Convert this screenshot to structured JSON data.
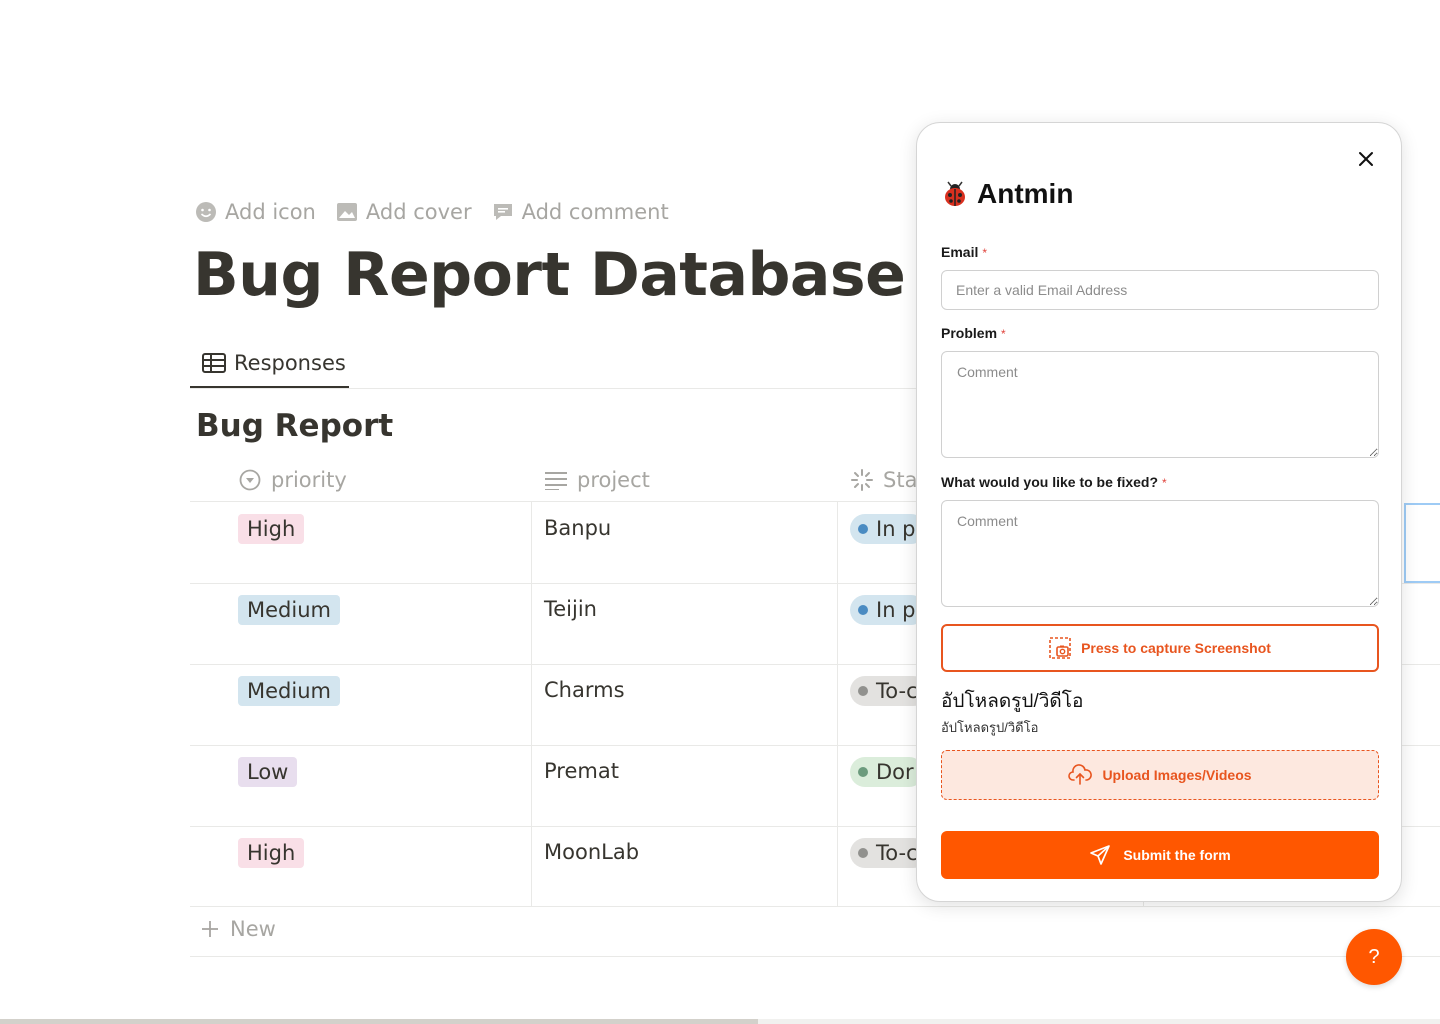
{
  "page": {
    "actions": [
      {
        "label": "Add icon",
        "icon": "smiley-icon"
      },
      {
        "label": "Add cover",
        "icon": "image-icon"
      },
      {
        "label": "Add comment",
        "icon": "comment-icon"
      }
    ],
    "title": "Bug Report Database",
    "view_tab": {
      "label": "Responses",
      "icon": "table-icon"
    },
    "database_title": "Bug Report",
    "columns": [
      {
        "label": "priority",
        "icon": "select-icon"
      },
      {
        "label": "project",
        "icon": "text-icon"
      },
      {
        "label": "Stat",
        "icon": "status-icon"
      }
    ],
    "rows": [
      {
        "priority": "High",
        "project": "Banpu",
        "status": "In p",
        "status_kind": "in-progress"
      },
      {
        "priority": "Medium",
        "project": "Teijin",
        "status": "In p",
        "status_kind": "in-progress"
      },
      {
        "priority": "Medium",
        "project": "Charms",
        "status": "To-c",
        "status_kind": "todo"
      },
      {
        "priority": "Low",
        "project": "Premat",
        "status": "Dor",
        "status_kind": "done"
      },
      {
        "priority": "High",
        "project": "MoonLab",
        "status": "To-c",
        "status_kind": "todo"
      }
    ],
    "new_row_label": "New"
  },
  "widget": {
    "brand_name": "Antmin",
    "brand_icon": "ladybug-icon",
    "email": {
      "label": "Email",
      "required_mark": "*",
      "placeholder": "Enter a valid Email Address",
      "value": ""
    },
    "problem": {
      "label": "Problem",
      "required_mark": "*",
      "placeholder": "Comment",
      "value": ""
    },
    "fix": {
      "label": "What would you like to be fixed?",
      "required_mark": "*",
      "placeholder": "Comment",
      "value": ""
    },
    "capture_label": "Press to capture Screenshot",
    "upload_title": "อัปโหลดรูป/วิดีโอ",
    "upload_subtitle": "อัปโหลดรูป/วิดีโอ",
    "upload_label": "Upload Images/Videos",
    "submit_label": "Submit the form",
    "help_label": "?"
  },
  "colors": {
    "accent": "#ff5700",
    "accent_outline": "#e8551f",
    "tag_high": "#f9dfe7",
    "tag_medium": "#d3e5ef",
    "tag_low": "#e8deee",
    "status_in_progress": "#d3e5ef",
    "status_todo": "#e3e2e0",
    "status_done": "#dbeddb"
  }
}
